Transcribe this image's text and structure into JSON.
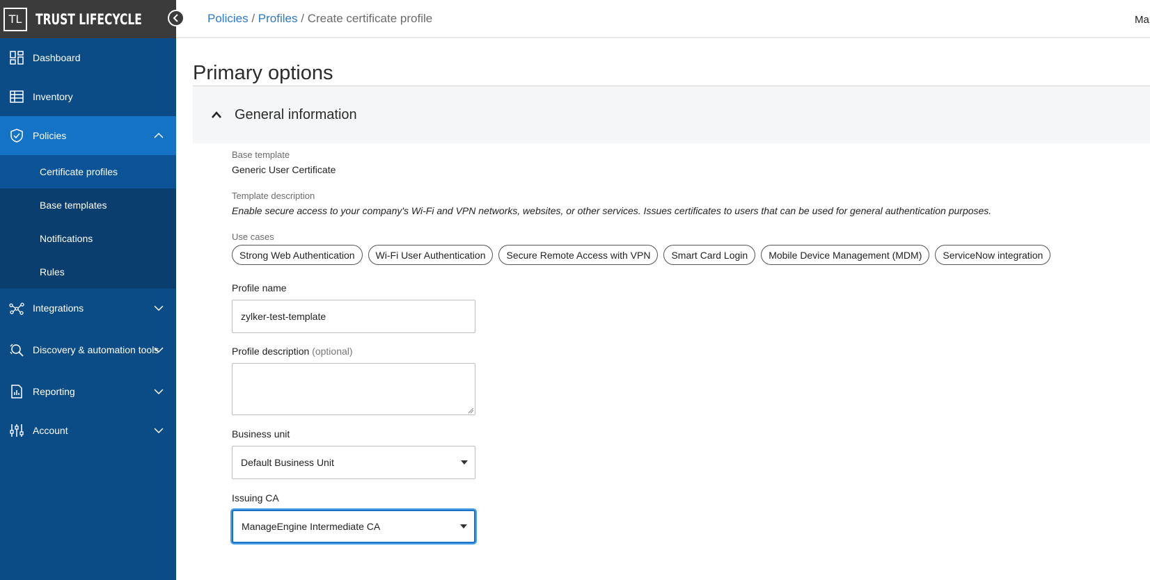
{
  "brand": {
    "logo": "TL",
    "name": "TRUST LIFECYCLE"
  },
  "sidebar": {
    "items": [
      {
        "label": "Dashboard",
        "icon": "dashboard-icon"
      },
      {
        "label": "Inventory",
        "icon": "inventory-icon"
      },
      {
        "label": "Policies",
        "icon": "shield-icon"
      },
      {
        "label": "Integrations",
        "icon": "integrations-icon"
      },
      {
        "label": "Discovery & automation tools",
        "icon": "discovery-icon"
      },
      {
        "label": "Reporting",
        "icon": "reporting-icon"
      },
      {
        "label": "Account",
        "icon": "account-icon"
      }
    ],
    "policies_sub": [
      "Certificate profiles",
      "Base templates",
      "Notifications",
      "Rules"
    ]
  },
  "header": {
    "breadcrumb": [
      "Policies",
      "Profiles",
      "Create certificate profile"
    ],
    "separator": "/",
    "user": "Mar"
  },
  "main": {
    "title": "Primary options",
    "section_title": "General information",
    "base_template_label": "Base template",
    "base_template_value": "Generic User Certificate",
    "template_description_label": "Template description",
    "template_description_value": "Enable secure access to your company's Wi-Fi and VPN networks, websites, or other services. Issues certificates to users that can be used for general authentication purposes.",
    "use_cases_label": "Use cases",
    "use_cases": [
      "Strong Web Authentication",
      "Wi-Fi User Authentication",
      "Secure Remote Access with VPN",
      "Smart Card Login",
      "Mobile Device Management (MDM)",
      "ServiceNow integration"
    ],
    "profile_name_label": "Profile name",
    "profile_name_value": "zylker-test-template",
    "profile_description_label": "Profile description",
    "profile_description_optional": "(optional)",
    "business_unit_label": "Business unit",
    "business_unit_value": "Default Business Unit",
    "issuing_ca_label": "Issuing CA",
    "issuing_ca_value": "ManageEngine Intermediate CA"
  },
  "colors": {
    "sidebar": "#0b4c86",
    "active": "#1473c4",
    "brand_bar": "#3b3b3b",
    "link": "#2a7ac9",
    "focus": "#1a73c9"
  }
}
